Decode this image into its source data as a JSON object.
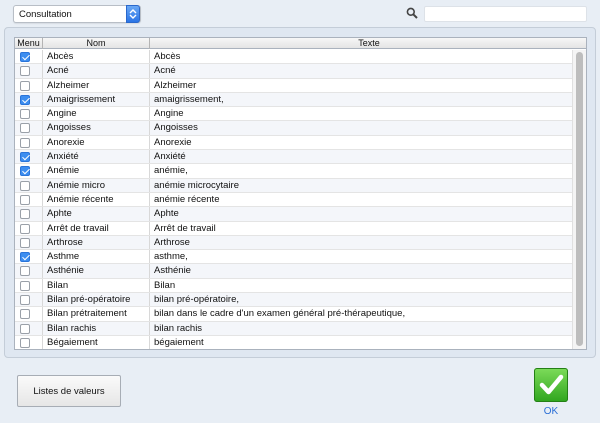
{
  "toolbar": {
    "category_value": "Consultation",
    "search_value": ""
  },
  "table": {
    "headers": {
      "menu": "Menu",
      "nom": "Nom",
      "texte": "Texte"
    },
    "rows": [
      {
        "checked": true,
        "nom": "Abcès",
        "texte": "Abcès"
      },
      {
        "checked": false,
        "nom": "Acné",
        "texte": "Acné"
      },
      {
        "checked": false,
        "nom": "Alzheimer",
        "texte": "Alzheimer"
      },
      {
        "checked": true,
        "nom": "Amaigrissement",
        "texte": "amaigrissement,"
      },
      {
        "checked": false,
        "nom": "Angine",
        "texte": "Angine"
      },
      {
        "checked": false,
        "nom": "Angoisses",
        "texte": "Angoisses"
      },
      {
        "checked": false,
        "nom": "Anorexie",
        "texte": "Anorexie"
      },
      {
        "checked": true,
        "nom": "Anxiété",
        "texte": "Anxiété"
      },
      {
        "checked": true,
        "nom": "Anémie",
        "texte": "anémie,"
      },
      {
        "checked": false,
        "nom": "Anémie micro",
        "texte": "anémie microcytaire"
      },
      {
        "checked": false,
        "nom": "Anémie récente",
        "texte": "anémie récente"
      },
      {
        "checked": false,
        "nom": "Aphte",
        "texte": "Aphte"
      },
      {
        "checked": false,
        "nom": "Arrêt de travail",
        "texte": "Arrêt de travail"
      },
      {
        "checked": false,
        "nom": "Arthrose",
        "texte": "Arthrose"
      },
      {
        "checked": true,
        "nom": "Asthme",
        "texte": "asthme,"
      },
      {
        "checked": false,
        "nom": "Asthénie",
        "texte": "Asthénie"
      },
      {
        "checked": false,
        "nom": "Bilan",
        "texte": "Bilan"
      },
      {
        "checked": false,
        "nom": "Bilan pré-opératoire",
        "texte": "bilan pré-opératoire,"
      },
      {
        "checked": false,
        "nom": "Bilan prétraitement",
        "texte": "bilan dans le cadre d'un examen général pré-thérapeutique,"
      },
      {
        "checked": false,
        "nom": "Bilan rachis",
        "texte": "bilan rachis"
      },
      {
        "checked": false,
        "nom": "Bégaiement",
        "texte": "bégaiement"
      }
    ]
  },
  "footer": {
    "values_button_label": "Listes de valeurs",
    "ok_label": "OK"
  },
  "colors": {
    "accent": "#3d8ef0",
    "ok_green": "#2fa51e",
    "ok_text": "#2b6fd6"
  }
}
